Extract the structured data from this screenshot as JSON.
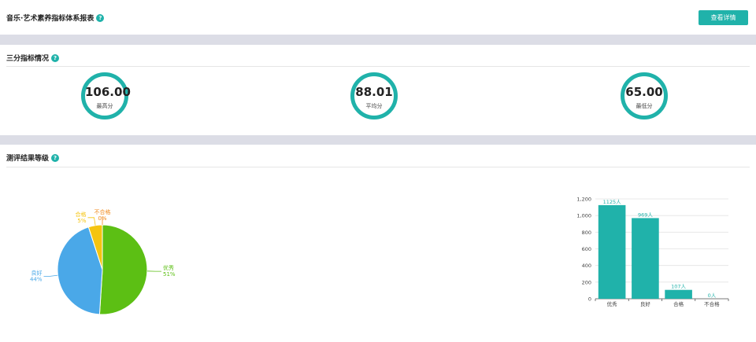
{
  "header": {
    "title": "音乐·艺术素养指标体系报表",
    "help_icon": "?",
    "detail_button": "查看详情"
  },
  "score_section": {
    "title": "三分指标情况",
    "help_icon": "?",
    "stats": [
      {
        "value": "106.00",
        "label": "最高分"
      },
      {
        "value": "88.01",
        "label": "平均分"
      },
      {
        "value": "65.00",
        "label": "最低分"
      }
    ]
  },
  "grade_section": {
    "title": "测评结果等级",
    "help_icon": "?"
  },
  "accent_color": "#20b2aa",
  "chart_data": [
    {
      "type": "pie",
      "slices": [
        {
          "name": "优秀",
          "value": 51,
          "label": "51%",
          "color": "#5cbf14"
        },
        {
          "name": "良好",
          "value": 44,
          "label": "44%",
          "color": "#4aa8e8"
        },
        {
          "name": "合格",
          "value": 5,
          "label": "5%",
          "color": "#f5c40f"
        },
        {
          "name": "不合格",
          "value": 0,
          "label": "0%",
          "color": "#f08a1c"
        }
      ]
    },
    {
      "type": "bar",
      "categories": [
        "优秀",
        "良好",
        "合格",
        "不合格"
      ],
      "values": [
        1125,
        969,
        107,
        0
      ],
      "data_labels": [
        "1125人",
        "969人",
        "107人",
        "0人"
      ],
      "ylim": [
        0,
        1200
      ],
      "yticks": [
        "0",
        "200",
        "400",
        "600",
        "800",
        "1,000",
        "1,200"
      ],
      "grid": true,
      "color": "#20b2aa"
    }
  ]
}
